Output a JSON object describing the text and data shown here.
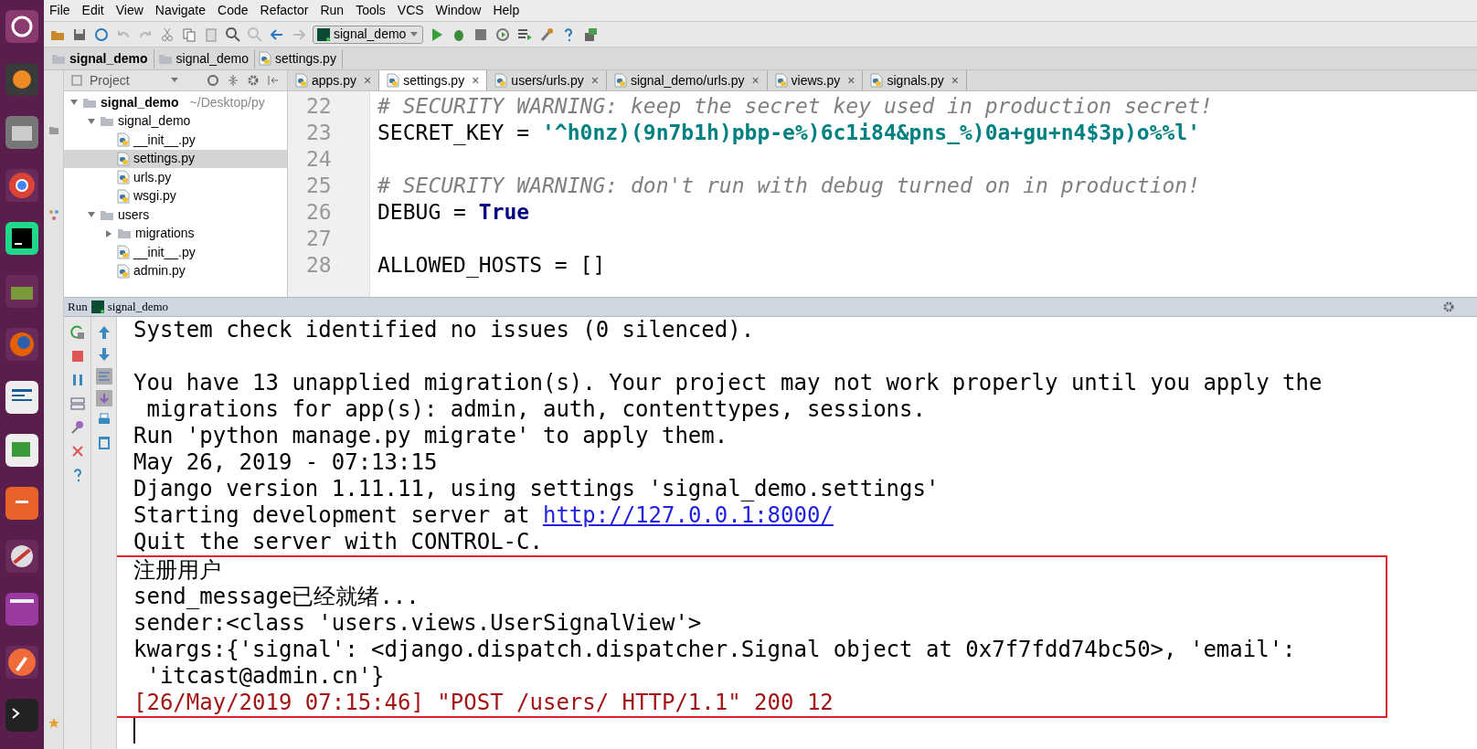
{
  "menu": [
    "File",
    "Edit",
    "View",
    "Navigate",
    "Code",
    "Refactor",
    "Run",
    "Tools",
    "VCS",
    "Window",
    "Help"
  ],
  "run_config": "signal_demo",
  "breadcrumb": [
    {
      "label": "signal_demo",
      "kind": "project"
    },
    {
      "label": "signal_demo",
      "kind": "folder"
    },
    {
      "label": "settings.py",
      "kind": "file"
    }
  ],
  "project_panel": {
    "title": "Project",
    "tree": [
      {
        "label": "signal_demo",
        "path": "~/Desktop/py",
        "kind": "project",
        "expanded": true,
        "selected": false,
        "children": [
          {
            "label": "signal_demo",
            "kind": "folder",
            "expanded": true,
            "selected": false,
            "children": [
              {
                "label": "__init__.py",
                "kind": "file",
                "selected": false
              },
              {
                "label": "settings.py",
                "kind": "file",
                "selected": true
              },
              {
                "label": "urls.py",
                "kind": "file",
                "selected": false
              },
              {
                "label": "wsgi.py",
                "kind": "file",
                "selected": false
              }
            ]
          },
          {
            "label": "users",
            "kind": "folder",
            "expanded": true,
            "selected": false,
            "children": [
              {
                "label": "migrations",
                "kind": "folder",
                "expanded": false,
                "selected": false
              },
              {
                "label": "__init__.py",
                "kind": "file",
                "selected": false
              },
              {
                "label": "admin.py",
                "kind": "file",
                "selected": false
              }
            ]
          }
        ]
      }
    ]
  },
  "tabs": [
    {
      "label": "apps.py",
      "close": "×",
      "selected": false
    },
    {
      "label": "settings.py",
      "close": "×",
      "selected": true
    },
    {
      "label": "users/urls.py",
      "close": "×",
      "selected": false
    },
    {
      "label": "signal_demo/urls.py",
      "close": "×",
      "selected": false
    },
    {
      "label": "views.py",
      "close": "×",
      "selected": false
    },
    {
      "label": "signals.py",
      "close": "×",
      "selected": false
    }
  ],
  "code": [
    {
      "number": "22",
      "tokens": [
        {
          "text": "# SECURITY WARNING: keep the secret key used in production secret!",
          "kind": "comment"
        }
      ]
    },
    {
      "number": "23",
      "tokens": [
        {
          "text": "SECRET_KEY = ",
          "kind": "plain"
        },
        {
          "text": "'^h0nz)(9n7b1h)pbp-e%)6c1i84&pns_%)0a+gu+n4$3p)o%%l'",
          "kind": "string"
        }
      ]
    },
    {
      "number": "24"
    },
    {
      "number": "25",
      "tokens": [
        {
          "text": "# SECURITY WARNING: don't run with debug turned on in production!",
          "kind": "comment"
        }
      ]
    },
    {
      "number": "26",
      "tokens": [
        {
          "text": "DEBUG = ",
          "kind": "plain"
        },
        {
          "text": "True",
          "kind": "keyword"
        }
      ]
    },
    {
      "number": "27"
    },
    {
      "number": "28",
      "tokens": [
        {
          "text": "ALLOWED_HOSTS = []",
          "kind": "plain"
        }
      ]
    }
  ],
  "run_panel": {
    "label": "Run",
    "config": "signal_demo",
    "lines": [
      {
        "kind": "normal",
        "parts": [
          {
            "text": "System check identified no issues (0 silenced)."
          }
        ]
      },
      {
        "kind": "blank"
      },
      {
        "kind": "normal",
        "parts": [
          {
            "text": "You have 13 unapplied migration(s). Your project may not work properly until you apply the"
          }
        ]
      },
      {
        "kind": "normal",
        "parts": [
          {
            "text": " migrations for app(s): admin, auth, contenttypes, sessions."
          }
        ]
      },
      {
        "kind": "normal",
        "parts": [
          {
            "text": "Run 'python manage.py migrate' to apply them."
          }
        ]
      },
      {
        "kind": "normal",
        "parts": [
          {
            "text": "May 26, 2019 - 07:13:15"
          }
        ]
      },
      {
        "kind": "normal",
        "parts": [
          {
            "text": "Django version 1.11.11, using settings 'signal_demo.settings'"
          }
        ]
      },
      {
        "kind": "normal",
        "parts": [
          {
            "text": "Starting development server at "
          },
          {
            "text": "http://127.0.0.1:8000/",
            "link": true
          }
        ]
      },
      {
        "kind": "normal",
        "parts": [
          {
            "text": "Quit the server with CONTROL-C."
          }
        ]
      }
    ],
    "boxed_lines": [
      {
        "kind": "normal",
        "parts": [
          {
            "text": "注册用户"
          }
        ]
      },
      {
        "kind": "normal",
        "parts": [
          {
            "text": "send_message已经就绪..."
          }
        ]
      },
      {
        "kind": "normal",
        "parts": [
          {
            "text": "sender:<class 'users.views.UserSignalView'>"
          }
        ]
      },
      {
        "kind": "normal",
        "parts": [
          {
            "text": "kwargs:{'signal': <django.dispatch.dispatcher.Signal object at 0x7f7fdd74bc50>, 'email':"
          }
        ]
      },
      {
        "kind": "normal",
        "parts": [
          {
            "text": " 'itcast@admin.cn'}"
          }
        ]
      },
      {
        "kind": "error",
        "parts": [
          {
            "text": "[26/May/2019 07:15:46] \"POST /users/ HTTP/1.1\" 200 12"
          }
        ]
      }
    ]
  }
}
